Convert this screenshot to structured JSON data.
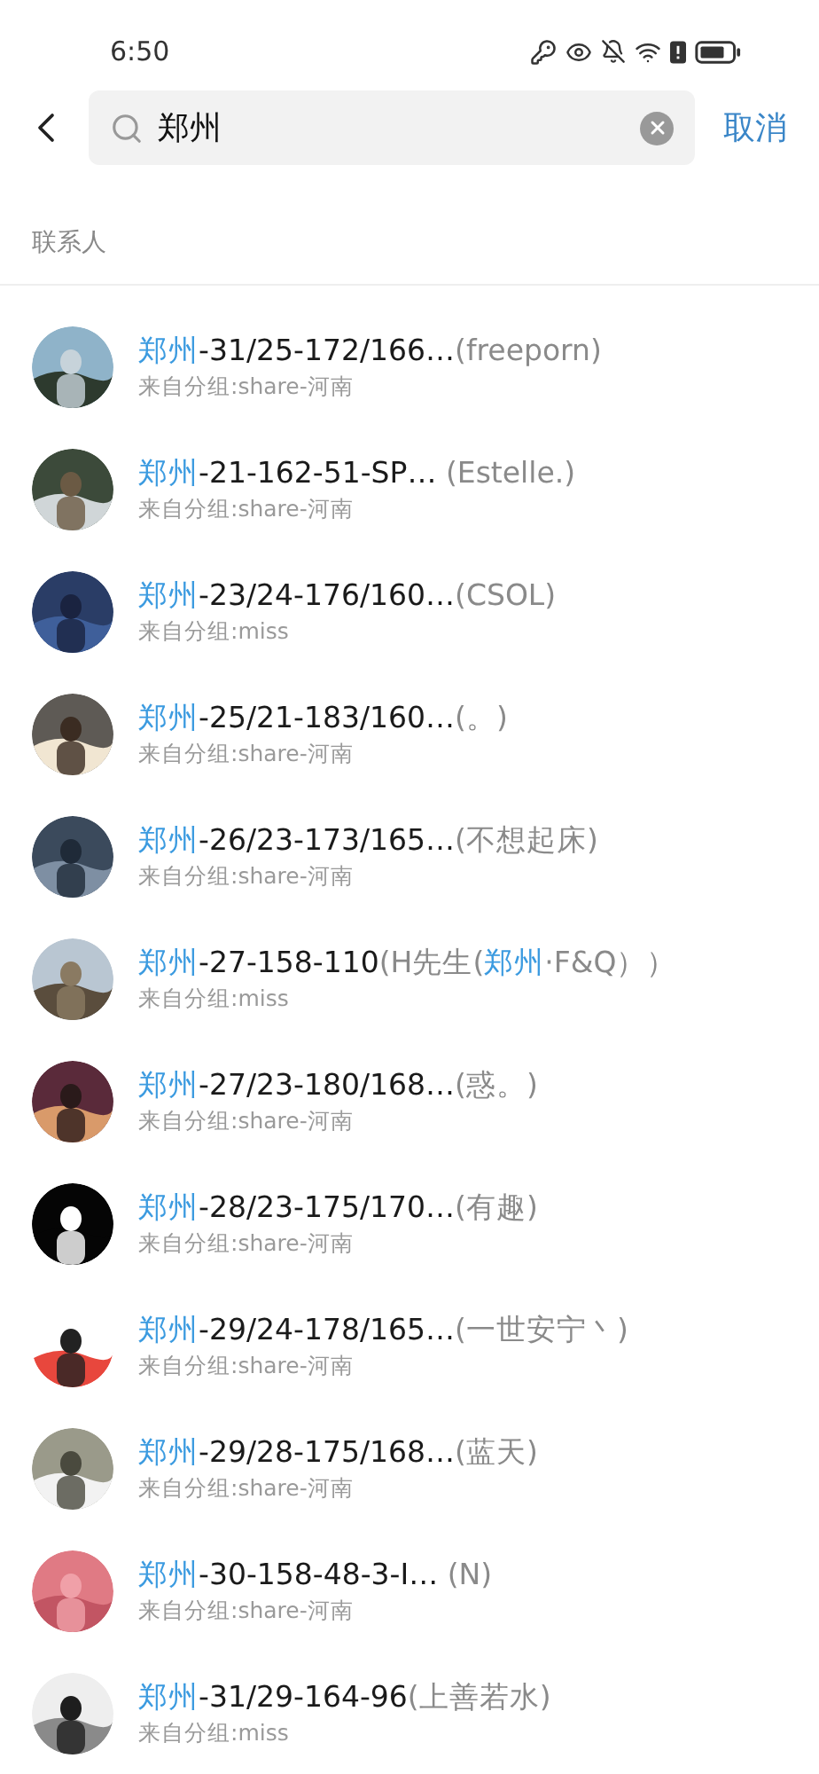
{
  "status_bar": {
    "time": "6:50"
  },
  "search": {
    "value": "郑州",
    "cancel": "取消"
  },
  "section": {
    "title": "联系人"
  },
  "contacts": [
    {
      "title": [
        {
          "kind": "match",
          "text": "郑州"
        },
        {
          "kind": "name",
          "text": "-31/25-172/166…"
        },
        {
          "kind": "nickname",
          "text": "(freeporn)"
        }
      ],
      "group": "来自分组:share-河南"
    },
    {
      "title": [
        {
          "kind": "match",
          "text": "郑州"
        },
        {
          "kind": "name",
          "text": "-21-162-51-SP… "
        },
        {
          "kind": "nickname",
          "text": "(Estelle.)"
        }
      ],
      "group": "来自分组:share-河南"
    },
    {
      "title": [
        {
          "kind": "match",
          "text": "郑州"
        },
        {
          "kind": "name",
          "text": "-23/24-176/160…"
        },
        {
          "kind": "nickname",
          "text": "(CSOL)"
        }
      ],
      "group": "来自分组:miss"
    },
    {
      "title": [
        {
          "kind": "match",
          "text": "郑州"
        },
        {
          "kind": "name",
          "text": "-25/21-183/160…"
        },
        {
          "kind": "nickname",
          "text": "(。)"
        }
      ],
      "group": "来自分组:share-河南"
    },
    {
      "title": [
        {
          "kind": "match",
          "text": "郑州"
        },
        {
          "kind": "name",
          "text": "-26/23-173/165…"
        },
        {
          "kind": "nickname",
          "text": "(不想起床)"
        }
      ],
      "group": "来自分组:share-河南"
    },
    {
      "title": [
        {
          "kind": "match",
          "text": "郑州"
        },
        {
          "kind": "name",
          "text": "-27-158-110"
        },
        {
          "kind": "nickname",
          "text": "(H先生("
        },
        {
          "kind": "match",
          "text": "郑州"
        },
        {
          "kind": "nickname",
          "text": "·F&Q））"
        }
      ],
      "group": "来自分组:miss"
    },
    {
      "title": [
        {
          "kind": "match",
          "text": "郑州"
        },
        {
          "kind": "name",
          "text": "-27/23-180/168…"
        },
        {
          "kind": "nickname",
          "text": "(惑。)"
        }
      ],
      "group": "来自分组:share-河南"
    },
    {
      "title": [
        {
          "kind": "match",
          "text": "郑州"
        },
        {
          "kind": "name",
          "text": "-28/23-175/170…"
        },
        {
          "kind": "nickname",
          "text": "(有趣)"
        }
      ],
      "group": "来自分组:share-河南"
    },
    {
      "title": [
        {
          "kind": "match",
          "text": "郑州"
        },
        {
          "kind": "name",
          "text": "-29/24-178/165…"
        },
        {
          "kind": "nickname",
          "text": "(一世安宁丶)"
        }
      ],
      "group": "来自分组:share-河南"
    },
    {
      "title": [
        {
          "kind": "match",
          "text": "郑州"
        },
        {
          "kind": "name",
          "text": "-29/28-175/168…"
        },
        {
          "kind": "nickname",
          "text": "(蓝天)"
        }
      ],
      "group": "来自分组:share-河南"
    },
    {
      "title": [
        {
          "kind": "match",
          "text": "郑州"
        },
        {
          "kind": "name",
          "text": "-30-158-48-3-I… "
        },
        {
          "kind": "nickname",
          "text": "(N)"
        }
      ],
      "group": "来自分组:share-河南"
    },
    {
      "title": [
        {
          "kind": "match",
          "text": "郑州"
        },
        {
          "kind": "name",
          "text": "-31/29-164-96"
        },
        {
          "kind": "nickname",
          "text": "(上善若水)"
        }
      ],
      "group": "来自分组:miss"
    }
  ]
}
